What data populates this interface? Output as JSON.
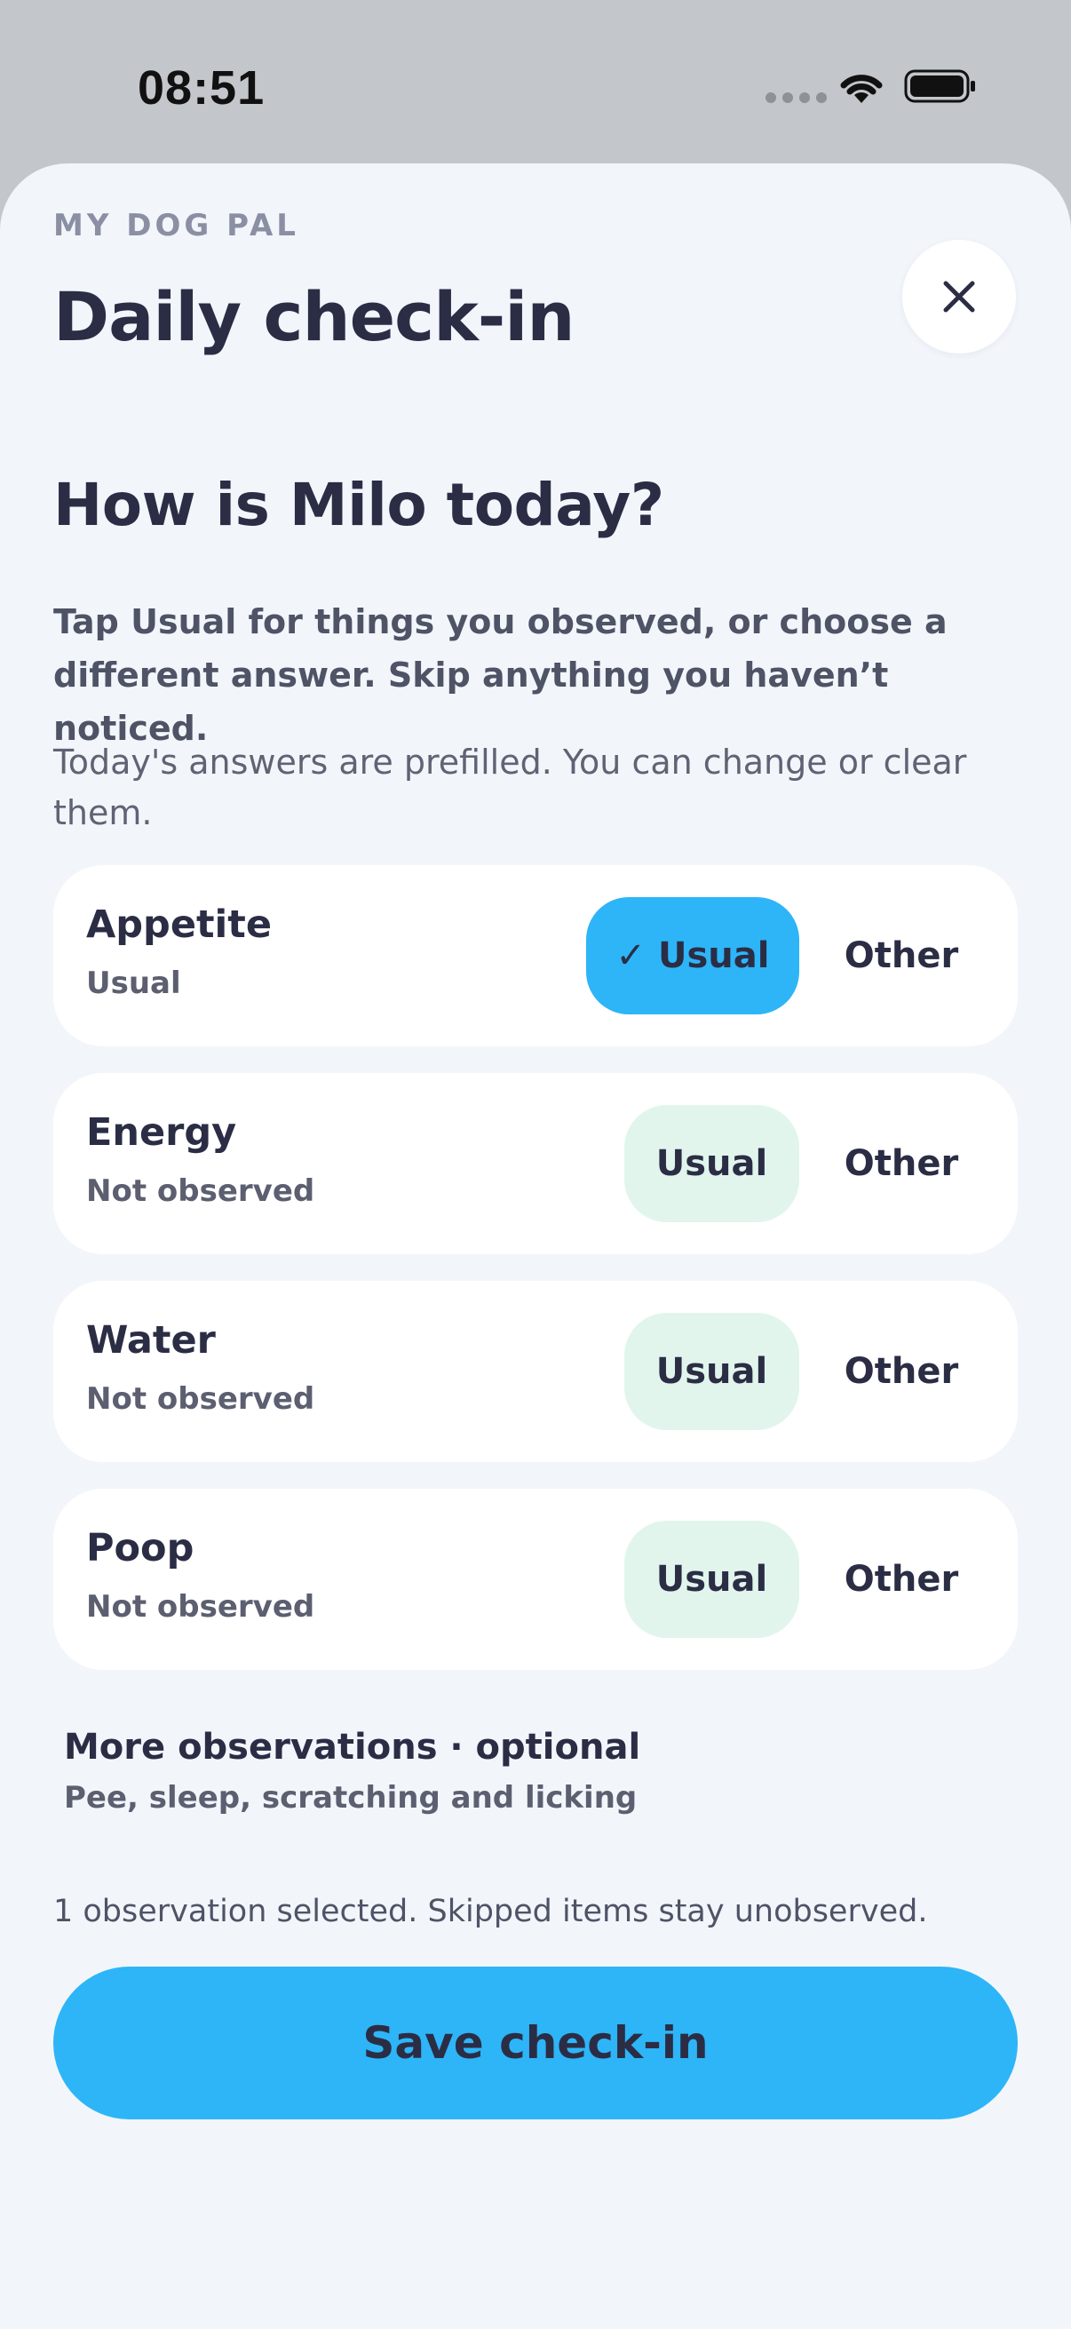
{
  "status_bar": {
    "time": "08:51"
  },
  "header": {
    "eyebrow": "MY DOG PAL",
    "title": "Daily check-in",
    "close_icon": "close-icon"
  },
  "main": {
    "question": "How is Milo today?",
    "instructions": "Tap Usual for things you observed, or choose a different answer. Skip anything you haven’t noticed.",
    "prefill_note": "Today's answers are prefilled. You can change or clear them.",
    "items": [
      {
        "title": "Appetite",
        "status": "Usual",
        "usual_label": "✓ Usual",
        "other_label": "Other",
        "selected": "usual"
      },
      {
        "title": "Energy",
        "status": "Not observed",
        "usual_label": "Usual",
        "other_label": "Other",
        "selected": "none"
      },
      {
        "title": "Water",
        "status": "Not observed",
        "usual_label": "Usual",
        "other_label": "Other",
        "selected": "none"
      },
      {
        "title": "Poop",
        "status": "Not observed",
        "usual_label": "Usual",
        "other_label": "Other",
        "selected": "none"
      }
    ],
    "more": {
      "title": "More observations · optional",
      "subtitle": "Pee, sleep, scratching and licking"
    },
    "summary": "1 observation selected. Skipped items stay unobserved.",
    "save_label": "Save check-in"
  },
  "colors": {
    "accent": "#2db5f7",
    "usual_unselected_bg": "#e1f5ec",
    "sheet_bg": "#f2f6fb",
    "text": "#2b2d45"
  }
}
